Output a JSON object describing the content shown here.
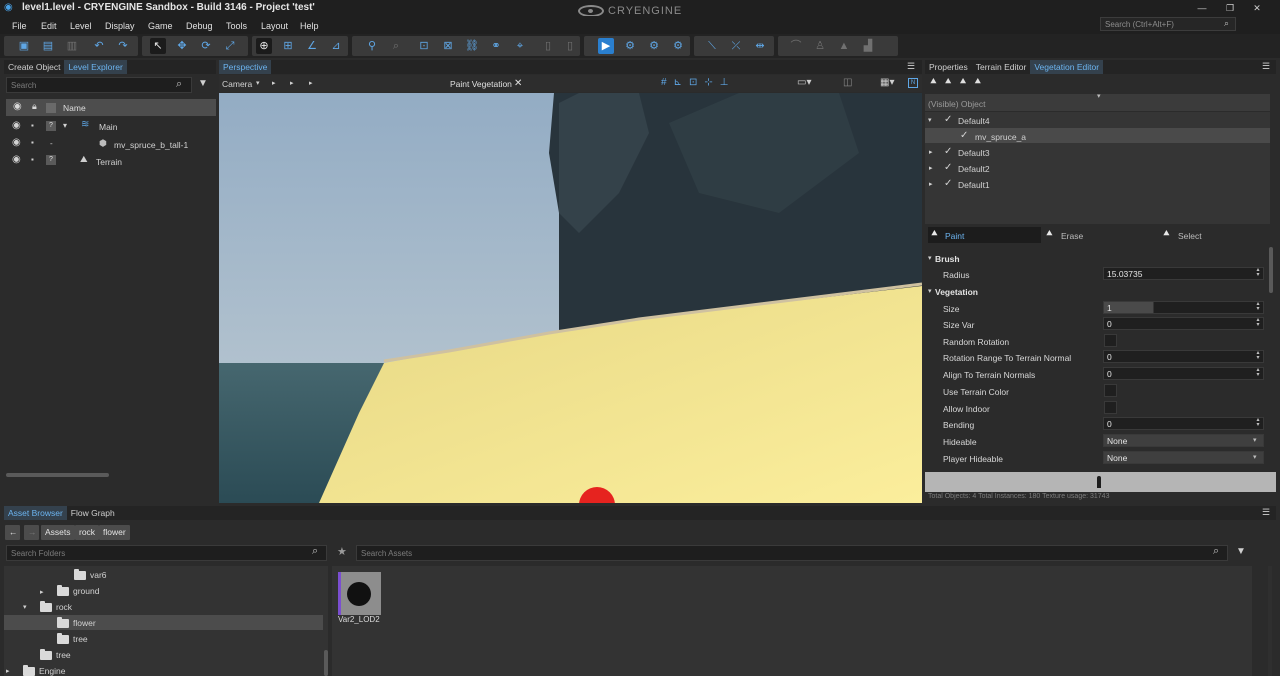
{
  "titlebar": {
    "title": "level1.level - CRYENGINE Sandbox - Build 3146 - Project 'test'",
    "logo": "CRYENGINE"
  },
  "menu": [
    "File",
    "Edit",
    "Level",
    "Display",
    "Game",
    "Debug",
    "Tools",
    "Layout",
    "Help"
  ],
  "search": {
    "placeholder": "Search (Ctrl+Alt+F)"
  },
  "left_panel": {
    "tabs": [
      "Create Object",
      "Level Explorer"
    ],
    "search_placeholder": "Search",
    "column": "Name",
    "items": [
      {
        "label": "Main",
        "icon": "layer-icon"
      },
      {
        "label": "mv_spruce_b_tall-1",
        "icon": "object-icon"
      },
      {
        "label": "Terrain",
        "icon": "terrain-icon"
      }
    ],
    "main_badge": "?",
    "terrain_badge": "?",
    "dash": "-"
  },
  "viewport": {
    "tab": "Perspective",
    "camera_label": "Camera",
    "mode_label": "Paint Vegetation",
    "close_glyph": "✕"
  },
  "right_panel": {
    "tabs": [
      "Properties",
      "Terrain Editor",
      "Vegetation Editor"
    ],
    "object_header": "(Visible) Object",
    "tree": [
      {
        "label": "Default4"
      },
      {
        "label": "mv_spruce_a"
      },
      {
        "label": "Default3"
      },
      {
        "label": "Default2"
      },
      {
        "label": "Default1"
      }
    ],
    "modes": [
      "Paint",
      "Erase",
      "Select"
    ],
    "sections": {
      "brush": "Brush",
      "vegetation": "Vegetation"
    },
    "props": {
      "radius": {
        "label": "Radius",
        "value": "15.03735"
      },
      "size": {
        "label": "Size",
        "value": "1"
      },
      "size_var": {
        "label": "Size Var",
        "value": "0"
      },
      "random_rotation": {
        "label": "Random Rotation"
      },
      "rotation_range": {
        "label": "Rotation Range To Terrain Normal",
        "value": "0"
      },
      "align": {
        "label": "Align To Terrain Normals",
        "value": "0"
      },
      "terrain_color": {
        "label": "Use Terrain Color"
      },
      "allow_indoor": {
        "label": "Allow Indoor"
      },
      "bending": {
        "label": "Bending",
        "value": "0"
      },
      "hideable": {
        "label": "Hideable",
        "value": "None"
      },
      "player_hideable": {
        "label": "Player Hideable",
        "value": "None"
      }
    },
    "status": "Total Objects: 4  Total Instances: 180  Texture usage: 31743"
  },
  "bottom": {
    "tabs": [
      "Asset Browser",
      "Flow Graph"
    ],
    "breadcrumb": [
      "Assets",
      "rock",
      "flower"
    ],
    "folder_search": "Search Folders",
    "asset_search": "Search Assets",
    "folders": [
      {
        "label": "var6"
      },
      {
        "label": "ground"
      },
      {
        "label": "rock"
      },
      {
        "label": "flower"
      },
      {
        "label": "tree"
      },
      {
        "label": "tree"
      },
      {
        "label": "Engine"
      }
    ],
    "asset": {
      "label": "Var2_LOD2"
    }
  }
}
